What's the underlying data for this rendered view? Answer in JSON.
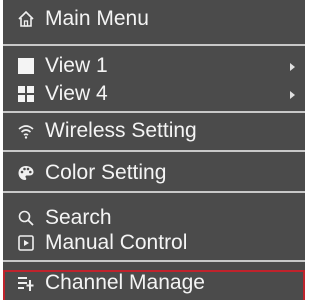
{
  "menu": {
    "items": [
      {
        "label": "Main Menu",
        "icon": "home-icon"
      },
      {
        "label": "View 1",
        "icon": "single-view-icon",
        "has_submenu": true
      },
      {
        "label": "View 4",
        "icon": "quad-view-icon",
        "has_submenu": true
      },
      {
        "label": "Wireless Setting",
        "icon": "wifi-icon"
      },
      {
        "label": "Color Setting",
        "icon": "palette-icon"
      },
      {
        "label": "Search",
        "icon": "search-icon"
      },
      {
        "label": "Manual Control",
        "icon": "manual-control-icon"
      },
      {
        "label": "Channel Manage",
        "icon": "channel-manage-icon",
        "selected": true
      }
    ]
  },
  "colors": {
    "menu_background": "#4b4b4b",
    "separator": "#c8c8c8",
    "text": "#f4f4f4",
    "selection_border": "#c0232c"
  }
}
